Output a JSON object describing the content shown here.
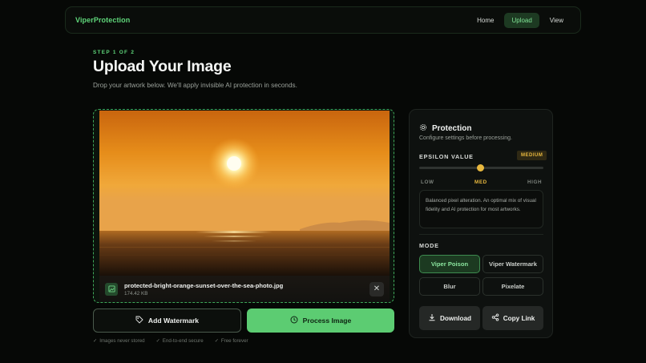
{
  "nav": {
    "brand": "ViperProtection",
    "links": [
      {
        "label": "Home",
        "active": false
      },
      {
        "label": "Upload",
        "active": true
      },
      {
        "label": "View",
        "active": false
      }
    ]
  },
  "header": {
    "step": "STEP 1 OF 2",
    "title": "Upload Your Image",
    "subtitle": "Drop your artwork below. We'll apply invisible AI protection in seconds."
  },
  "upload": {
    "file_name": "protected-bright-orange-sunset-over-the-sea-photo.jpg",
    "file_size": "174.42 KB",
    "remove_icon": "close-icon",
    "file_icon": "image-icon"
  },
  "actions": {
    "watermark_label": "Add Watermark",
    "watermark_icon": "tag-icon",
    "process_label": "Process Image",
    "process_icon": "clock-icon"
  },
  "badges": [
    "Images never stored",
    "End-to-end secure",
    "Free forever"
  ],
  "panel": {
    "icon": "gear-icon",
    "title": "Protection",
    "subtitle": "Configure settings before processing.",
    "epsilon": {
      "label": "EPSILON VALUE",
      "badge": "MEDIUM",
      "value": 0.5,
      "ticks": [
        "LOW",
        "MED",
        "HIGH"
      ]
    },
    "description": "Balanced pixel alteration. An optimal mix of visual fidelity and AI protection for most artworks.",
    "mode_label": "MODE",
    "modes": [
      {
        "label": "Viper Poison",
        "active": true
      },
      {
        "label": "Viper Watermark",
        "active": false
      },
      {
        "label": "Blur",
        "active": false
      },
      {
        "label": "Pixelate",
        "active": false
      }
    ],
    "download_label": "Download",
    "copy_label": "Copy Link"
  },
  "colors": {
    "accent": "#5ccc72",
    "warning": "#e8b83e",
    "background": "#060806"
  }
}
